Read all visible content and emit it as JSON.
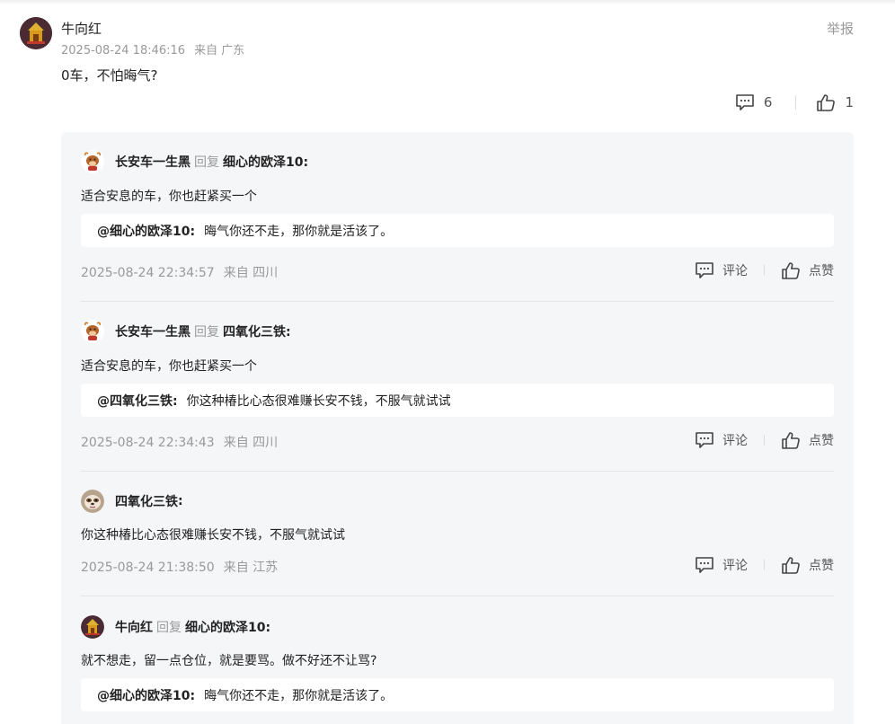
{
  "main_comment": {
    "author": "牛向红",
    "time": "2025-08-24 18:46:16",
    "location": "来自 广东",
    "text": "0车，不怕晦气?",
    "report_label": "举报",
    "comment_count": "6",
    "like_count": "1"
  },
  "labels": {
    "reply_word": "回复",
    "comment_label": "评论",
    "like_label": "点赞"
  },
  "replies": [
    {
      "author": "长安车一生黑",
      "reply_to": "细心的欧泽10",
      "text": "适合安息的车，你也赶紧买一个",
      "quote_user": "@细心的欧泽10",
      "quote_text": "晦气你还不走，那你就是活该了。",
      "time": "2025-08-24 22:34:57",
      "location": "来自 四川"
    },
    {
      "author": "长安车一生黑",
      "reply_to": "四氧化三铁",
      "text": "适合安息的车，你也赶紧买一个",
      "quote_user": "@四氧化三铁",
      "quote_text": "你这种椿比心态很难赚长安不钱，不服气就试试",
      "time": "2025-08-24 22:34:43",
      "location": "来自 四川"
    },
    {
      "author": "四氧化三铁",
      "text": "你这种椿比心态很难赚长安不钱，不服气就试试",
      "time": "2025-08-24 21:38:50",
      "location": "来自 江苏"
    },
    {
      "author": "牛向红",
      "reply_to": "细心的欧泽10",
      "text": "就不想走，留一点仓位，就是要骂。做不好还不让骂?",
      "quote_user": "@细心的欧泽10",
      "quote_text": "晦气你还不走，那你就是活该了。"
    }
  ],
  "colors": {
    "text": "#222222",
    "muted": "#999999",
    "reply_bg": "#f5f6f8",
    "quote_bg": "#ffffff"
  },
  "icons": {
    "comment": "comment-bubble-icon",
    "like": "thumbs-up-icon",
    "avatar_main": "temple-avatar",
    "avatar_ox": "ox-cartoon-avatar",
    "avatar_sloth": "sloth-avatar"
  }
}
